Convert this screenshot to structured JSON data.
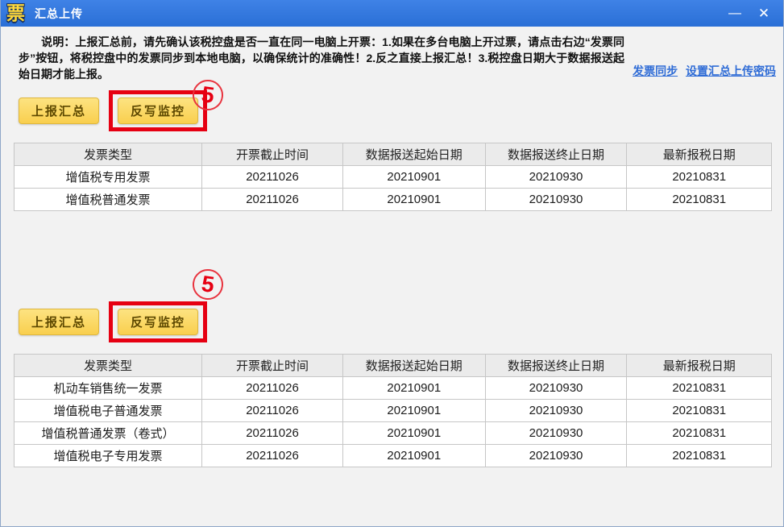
{
  "window": {
    "app_icon": "票",
    "title": "汇总上传",
    "minimize_icon": "—",
    "close_icon": "✕"
  },
  "notice": {
    "label": "说明：",
    "text": "上报汇总前，请先确认该税控盘是否一直在同一电脑上开票：1.如果在多台电脑上开过票，请点击右边“发票同步”按钮，将税控盘中的发票同步到本地电脑，以确保统计的准确性！2.反之直接上报汇总！3.税控盘日期大于数据报送起始日期才能上报。"
  },
  "links": {
    "invoice_sync": "发票同步",
    "set_upload_password": "设置汇总上传密码"
  },
  "annotation": {
    "number": "5"
  },
  "buttons": {
    "report_summary": "上报汇总",
    "writeback_monitor": "反写监控"
  },
  "table_headers": [
    "发票类型",
    "开票截止时间",
    "数据报送起始日期",
    "数据报送终止日期",
    "最新报税日期"
  ],
  "sections": [
    {
      "table": {
        "rows": [
          [
            "增值税专用发票",
            "20211026",
            "20210901",
            "20210930",
            "20210831"
          ],
          [
            "增值税普通发票",
            "20211026",
            "20210901",
            "20210930",
            "20210831"
          ]
        ]
      }
    },
    {
      "table": {
        "rows": [
          [
            "机动车销售统一发票",
            "20211026",
            "20210901",
            "20210930",
            "20210831"
          ],
          [
            "增值税电子普通发票",
            "20211026",
            "20210901",
            "20210930",
            "20210831"
          ],
          [
            "增值税普通发票（卷式）",
            "20211026",
            "20210901",
            "20210930",
            "20210831"
          ],
          [
            "增值税电子专用发票",
            "20211026",
            "20210901",
            "20210930",
            "20210831"
          ]
        ]
      }
    }
  ],
  "colors": {
    "titlebar_blue": "#2d73da",
    "link_blue": "#2f6cd6",
    "button_yellow": "#fbd85e",
    "highlight_red": "#e60012",
    "table_header_gray": "#ebebeb",
    "table_border_gray": "#c6c6c6"
  }
}
